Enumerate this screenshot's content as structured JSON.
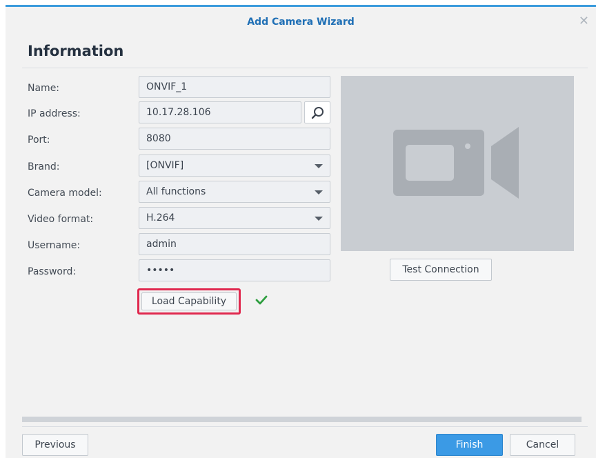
{
  "dialog": {
    "title": "Add Camera Wizard",
    "section_title": "Information"
  },
  "form": {
    "fields": [
      {
        "label": "Name:",
        "value": "ONVIF_1"
      },
      {
        "label": "IP address:",
        "value": "10.17.28.106"
      },
      {
        "label": "Port:",
        "value": "8080"
      },
      {
        "label": "Brand:",
        "value": "[ONVIF]"
      },
      {
        "label": "Camera model:",
        "value": "All functions"
      },
      {
        "label": "Video format:",
        "value": "H.264"
      },
      {
        "label": "Username:",
        "value": "admin"
      },
      {
        "label": "Password:",
        "value": "•••••"
      }
    ],
    "load_capability_label": "Load Capability",
    "load_status": "success"
  },
  "preview": {
    "icon": "video-camera-icon",
    "test_connection_label": "Test Connection"
  },
  "footer": {
    "previous_label": "Previous",
    "finish_label": "Finish",
    "cancel_label": "Cancel"
  },
  "colors": {
    "accent": "#3b9ae5",
    "highlight": "#e0284e",
    "success": "#2e9e3f"
  }
}
